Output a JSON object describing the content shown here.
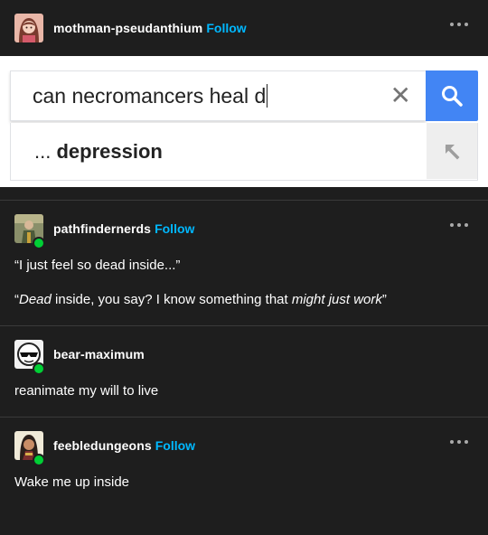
{
  "original_post": {
    "username": "mothman-pseudanthium",
    "follow_label": "Follow",
    "avatar_icon": "avatar-girl-icon",
    "image": {
      "search_query": "can necromancers heal d",
      "suggestion_prefix": "... ",
      "suggestion_bold": "depression",
      "clear_icon": "close-icon",
      "search_icon": "search-icon",
      "arrow_icon": "arrow-up-left-icon"
    }
  },
  "reblogs": [
    {
      "username": "pathfindernerds",
      "follow_label": "Follow",
      "avatar_icon": "avatar-character-icon",
      "lines": [
        "“I just feel so dead inside...”"
      ],
      "line2": {
        "open": "“",
        "em1": "Dead",
        "mid": " inside, you say? I know something that ",
        "em2": "might just work",
        "close": "”"
      }
    },
    {
      "username": "bear-maximum",
      "avatar_icon": "avatar-sunglasses-icon",
      "text": "reanimate my will to live"
    },
    {
      "username": "feebledungeons",
      "follow_label": "Follow",
      "avatar_icon": "avatar-warrior-icon",
      "text": "Wake me up inside"
    }
  ],
  "colors": {
    "background": "#1e1e1e",
    "accent": "#00b8ff",
    "reblog_badge": "#00cf35",
    "google_blue": "#4285f4"
  }
}
